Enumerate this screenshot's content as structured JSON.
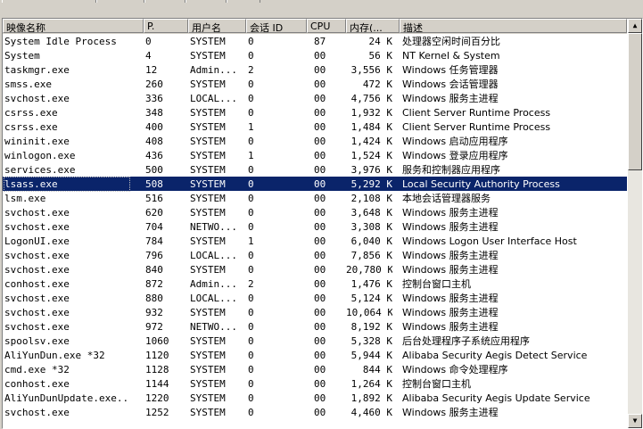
{
  "columns": [
    {
      "key": "image",
      "label": "映像名称"
    },
    {
      "key": "pid",
      "label": "P."
    },
    {
      "key": "user",
      "label": "用户名"
    },
    {
      "key": "session",
      "label": "会话 ID"
    },
    {
      "key": "cpu",
      "label": "CPU"
    },
    {
      "key": "mem",
      "label": "内存(..."
    },
    {
      "key": "desc",
      "label": "描述"
    }
  ],
  "selected_row_index": 11,
  "rows": [
    {
      "image": "System Idle Process",
      "pid": "0",
      "user": "SYSTEM",
      "session": "0",
      "cpu": "87",
      "mem": "24 K",
      "desc": "处理器空闲时间百分比"
    },
    {
      "image": "System",
      "pid": "4",
      "user": "SYSTEM",
      "session": "0",
      "cpu": "00",
      "mem": "56 K",
      "desc": "NT Kernel & System"
    },
    {
      "image": "taskmgr.exe",
      "pid": "12",
      "user": "Admin...",
      "session": "2",
      "cpu": "00",
      "mem": "3,556 K",
      "desc": "Windows 任务管理器"
    },
    {
      "image": "smss.exe",
      "pid": "260",
      "user": "SYSTEM",
      "session": "0",
      "cpu": "00",
      "mem": "472 K",
      "desc": "Windows 会话管理器"
    },
    {
      "image": "svchost.exe",
      "pid": "336",
      "user": "LOCAL...",
      "session": "0",
      "cpu": "00",
      "mem": "4,756 K",
      "desc": "Windows 服务主进程"
    },
    {
      "image": "csrss.exe",
      "pid": "348",
      "user": "SYSTEM",
      "session": "0",
      "cpu": "00",
      "mem": "1,932 K",
      "desc": "Client Server Runtime Process"
    },
    {
      "image": "csrss.exe",
      "pid": "400",
      "user": "SYSTEM",
      "session": "1",
      "cpu": "00",
      "mem": "1,484 K",
      "desc": "Client Server Runtime Process"
    },
    {
      "image": "wininit.exe",
      "pid": "408",
      "user": "SYSTEM",
      "session": "0",
      "cpu": "00",
      "mem": "1,424 K",
      "desc": "Windows 启动应用程序"
    },
    {
      "image": "winlogon.exe",
      "pid": "436",
      "user": "SYSTEM",
      "session": "1",
      "cpu": "00",
      "mem": "1,524 K",
      "desc": "Windows 登录应用程序"
    },
    {
      "image": "services.exe",
      "pid": "500",
      "user": "SYSTEM",
      "session": "0",
      "cpu": "00",
      "mem": "3,976 K",
      "desc": "服务和控制器应用程序"
    },
    {
      "image": "lsass.exe",
      "pid": "508",
      "user": "SYSTEM",
      "session": "0",
      "cpu": "00",
      "mem": "5,292 K",
      "desc": "Local Security Authority Process"
    },
    {
      "image": "lsm.exe",
      "pid": "516",
      "user": "SYSTEM",
      "session": "0",
      "cpu": "00",
      "mem": "2,108 K",
      "desc": "本地会话管理器服务"
    },
    {
      "image": "svchost.exe",
      "pid": "620",
      "user": "SYSTEM",
      "session": "0",
      "cpu": "00",
      "mem": "3,648 K",
      "desc": "Windows 服务主进程"
    },
    {
      "image": "svchost.exe",
      "pid": "704",
      "user": "NETWO...",
      "session": "0",
      "cpu": "00",
      "mem": "3,308 K",
      "desc": "Windows 服务主进程"
    },
    {
      "image": "LogonUI.exe",
      "pid": "784",
      "user": "SYSTEM",
      "session": "1",
      "cpu": "00",
      "mem": "6,040 K",
      "desc": "Windows Logon User Interface Host"
    },
    {
      "image": "svchost.exe",
      "pid": "796",
      "user": "LOCAL...",
      "session": "0",
      "cpu": "00",
      "mem": "7,856 K",
      "desc": "Windows 服务主进程"
    },
    {
      "image": "svchost.exe",
      "pid": "840",
      "user": "SYSTEM",
      "session": "0",
      "cpu": "00",
      "mem": "20,780 K",
      "desc": "Windows 服务主进程"
    },
    {
      "image": "conhost.exe",
      "pid": "872",
      "user": "Admin...",
      "session": "2",
      "cpu": "00",
      "mem": "1,476 K",
      "desc": "控制台窗口主机"
    },
    {
      "image": "svchost.exe",
      "pid": "880",
      "user": "LOCAL...",
      "session": "0",
      "cpu": "00",
      "mem": "5,124 K",
      "desc": "Windows 服务主进程"
    },
    {
      "image": "svchost.exe",
      "pid": "932",
      "user": "SYSTEM",
      "session": "0",
      "cpu": "00",
      "mem": "10,064 K",
      "desc": "Windows 服务主进程"
    },
    {
      "image": "svchost.exe",
      "pid": "972",
      "user": "NETWO...",
      "session": "0",
      "cpu": "00",
      "mem": "8,192 K",
      "desc": "Windows 服务主进程"
    },
    {
      "image": "spoolsv.exe",
      "pid": "1060",
      "user": "SYSTEM",
      "session": "0",
      "cpu": "00",
      "mem": "5,328 K",
      "desc": "后台处理程序子系统应用程序"
    },
    {
      "image": "AliYunDun.exe *32",
      "pid": "1120",
      "user": "SYSTEM",
      "session": "0",
      "cpu": "00",
      "mem": "5,944 K",
      "desc": "Alibaba Security Aegis Detect Service"
    },
    {
      "image": "cmd.exe *32",
      "pid": "1128",
      "user": "SYSTEM",
      "session": "0",
      "cpu": "00",
      "mem": "844 K",
      "desc": "Windows 命令处理程序"
    },
    {
      "image": "conhost.exe",
      "pid": "1144",
      "user": "SYSTEM",
      "session": "0",
      "cpu": "00",
      "mem": "1,264 K",
      "desc": "控制台窗口主机"
    },
    {
      "image": "AliYunDunUpdate.exe...",
      "pid": "1220",
      "user": "SYSTEM",
      "session": "0",
      "cpu": "00",
      "mem": "1,892 K",
      "desc": "Alibaba Security Aegis Update Service"
    },
    {
      "image": "svchost.exe",
      "pid": "1252",
      "user": "SYSTEM",
      "session": "0",
      "cpu": "00",
      "mem": "4,460 K",
      "desc": "Windows 服务主进程"
    }
  ],
  "scrollbar": {
    "up_icon": "arrow-up-icon",
    "down_icon": "arrow-down-icon",
    "position": 0.0
  }
}
